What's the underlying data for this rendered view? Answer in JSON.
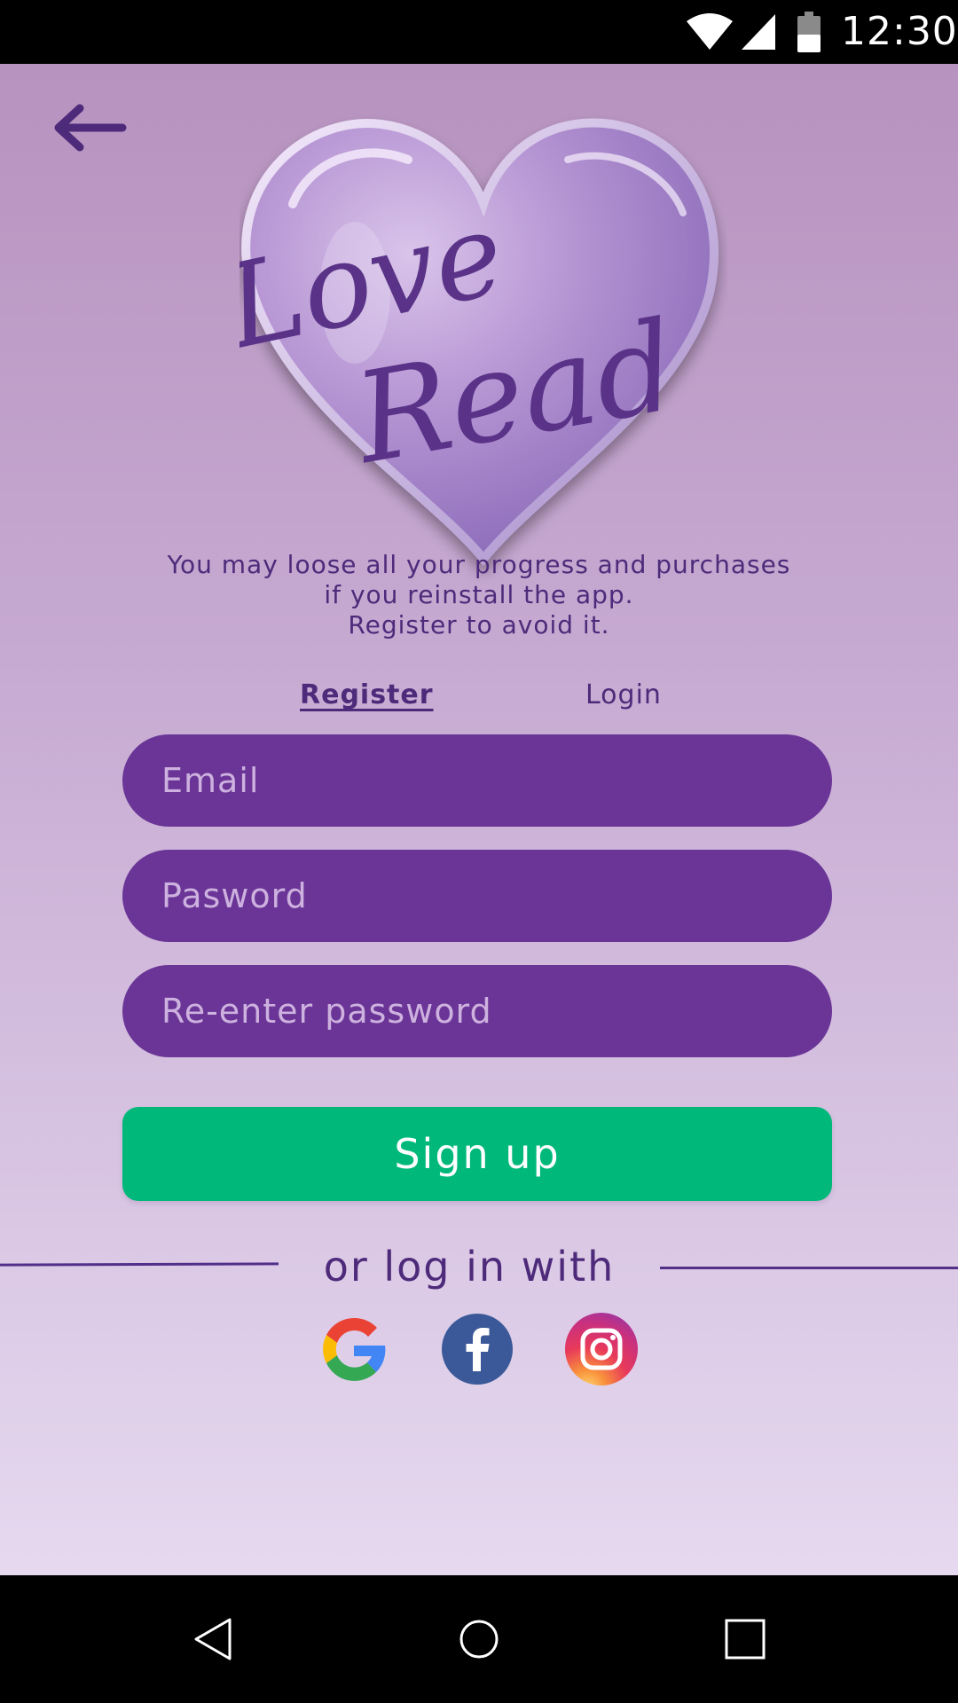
{
  "status_bar": {
    "time": "12:30",
    "icons": [
      "wifi-icon",
      "cell-signal-icon",
      "battery-icon"
    ]
  },
  "header": {
    "back_icon": "arrow-left-icon"
  },
  "logo": {
    "line1": "Love",
    "line2": "Read"
  },
  "notice": {
    "lines": [
      "You may loose all your progress and purchases",
      "if you reinstall the app.",
      "Register to avoid it."
    ]
  },
  "tabs": [
    {
      "label": "Register",
      "active": true
    },
    {
      "label": "Login",
      "active": false
    }
  ],
  "form": {
    "email_placeholder": "Email",
    "password_placeholder": "Pasword",
    "reenter_placeholder": "Re-enter password",
    "submit_label": "Sign up"
  },
  "alt_login": {
    "label": "or log in with",
    "providers": [
      "google-icon",
      "facebook-icon",
      "instagram-icon"
    ]
  },
  "nav_bar": {
    "icons": [
      "nav-back-icon",
      "nav-home-icon",
      "nav-recents-icon"
    ]
  },
  "colors": {
    "field_bg": "#6a3597",
    "accent_green": "#00b87a",
    "text_purple": "#4e2a7a",
    "bg_top": "#b793bf",
    "bg_bottom": "#e6d9ef"
  }
}
